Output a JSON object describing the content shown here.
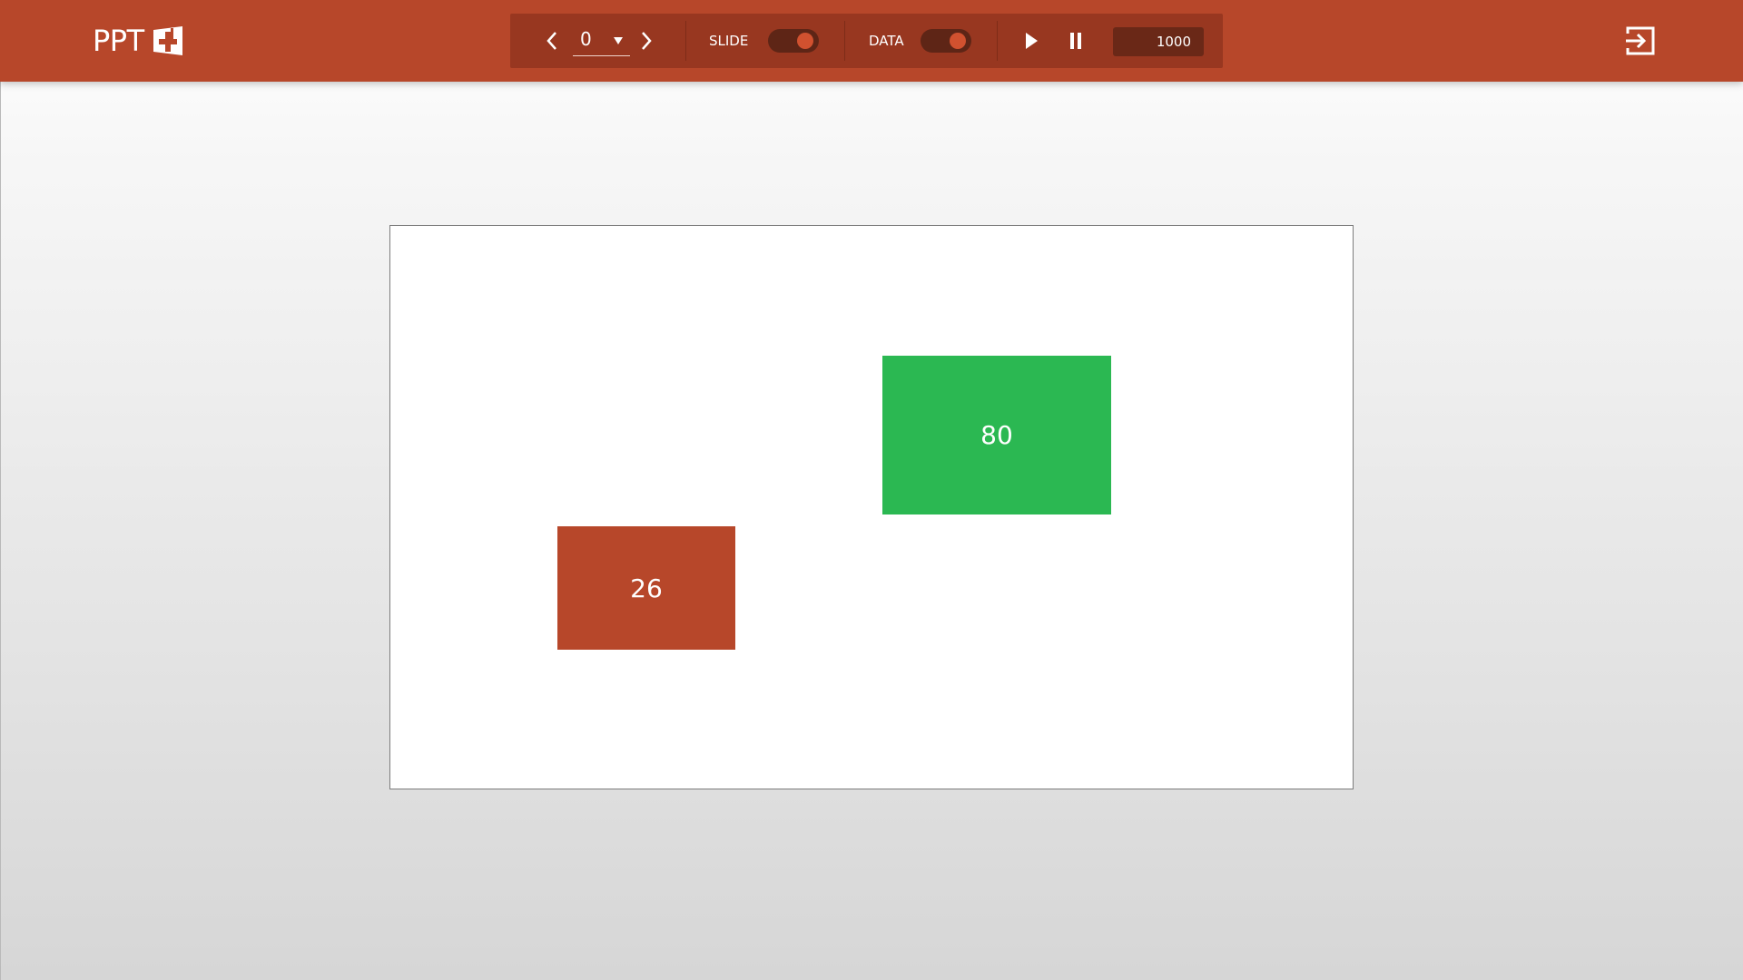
{
  "app": {
    "logo_text": "PPT"
  },
  "toolbar": {
    "slide_number": "0",
    "slide_toggle_label": "SLIDE",
    "data_toggle_label": "DATA",
    "speed_value": "1000"
  },
  "slide": {
    "boxes": [
      {
        "label": "26",
        "color": "#b7472a"
      },
      {
        "label": "80",
        "color": "#2bb852"
      }
    ]
  },
  "icons": {
    "prev": "chevron-left-icon",
    "next": "chevron-right-icon",
    "dropdown": "caret-down-icon",
    "play": "play-icon",
    "pause": "pause-icon",
    "exit": "exit-icon",
    "logo": "powerpoint-plus-icon"
  },
  "colors": {
    "header": "#b7472a",
    "toolbar": "#983720",
    "toggle_knob": "#d1512f"
  }
}
